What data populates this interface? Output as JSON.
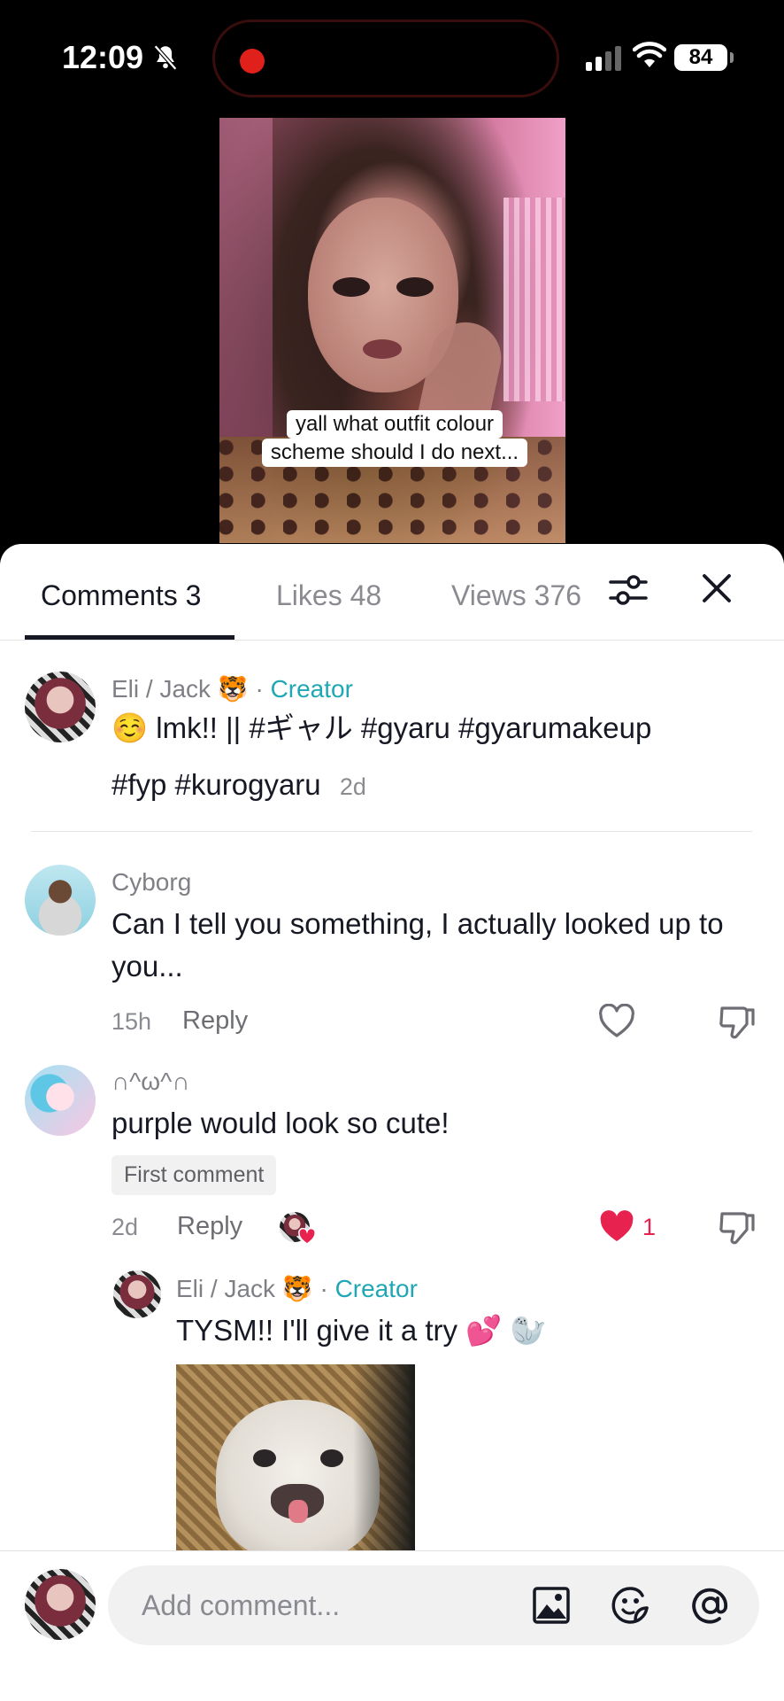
{
  "status_bar": {
    "time": "12:09",
    "battery": "84"
  },
  "video": {
    "caption_line1": "yall what outfit colour",
    "caption_line2": "scheme should I do next..."
  },
  "tabs": [
    {
      "label": "Comments 3"
    },
    {
      "label": "Likes 48"
    },
    {
      "label": "Views 376"
    }
  ],
  "creator_post": {
    "username": "Eli / Jack 🐯",
    "creator_tag": "Creator",
    "separator": "·",
    "text_line1": "☺️ lmk!! || #ギャル #gyaru #gyarumakeup",
    "text_line2": "#fyp #kurogyaru",
    "time": "2d"
  },
  "comments": [
    {
      "username": "Cyborg",
      "text": "Can I tell you something, I actually looked up to you...",
      "time": "15h",
      "reply_label": "Reply"
    },
    {
      "username": "∩^ω^∩",
      "text": "purple would look so cute!",
      "badge": "First comment",
      "time": "2d",
      "reply_label": "Reply",
      "like_count": "1"
    }
  ],
  "reply": {
    "username": "Eli / Jack 🐯",
    "creator_tag": "Creator",
    "separator": "·",
    "text": "TYSM!! I'll give it a try 💕 🦭"
  },
  "comment_bar": {
    "placeholder": "Add comment..."
  },
  "icons": {
    "bell_off": "bell-slash-icon",
    "filter": "sliders-icon",
    "close": "close-icon",
    "heart": "heart-icon",
    "dislike": "thumbs-down-icon",
    "image": "image-icon",
    "emoji": "emoji-sticker-icon",
    "mention": "at-sign-icon"
  },
  "colors": {
    "accent_creator": "#20a7b5",
    "like_red": "#e8224e",
    "text": "#161823",
    "muted": "#8a8b91"
  }
}
